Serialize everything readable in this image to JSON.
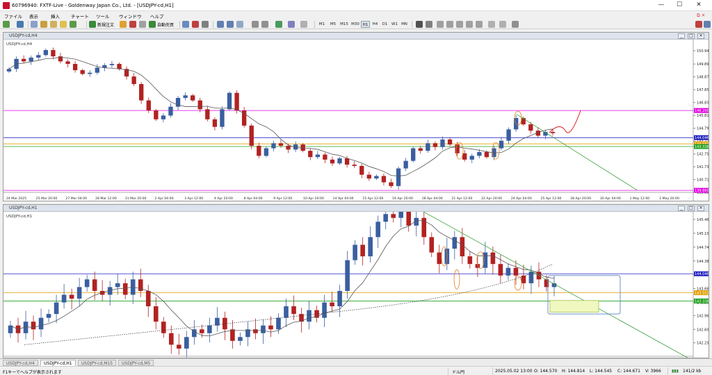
{
  "window": {
    "title": "60796940: FXTF-Live - Goldenway Japan Co., Ltd. - [USDJPY-cd,H1]",
    "minimize": "—",
    "maximize": "☐",
    "close": "✕"
  },
  "menu": [
    "ファイル",
    "表示",
    "挿入",
    "チャート",
    "ツール",
    "ウィンドウ",
    "ヘルプ"
  ],
  "toolbar": {
    "new_order": "新規注文",
    "auto_trade": "自動売買",
    "timeframes": [
      "M1",
      "M5",
      "M15",
      "M30",
      "H1",
      "H4",
      "D1",
      "W1",
      "MN"
    ]
  },
  "charts": [
    {
      "title": "USDJPY-cd,H4",
      "label": "USDJPY-cd,H4",
      "price_min": 139.7,
      "price_max": 151.5,
      "price_ticks": [
        "150.940",
        "149.890",
        "148.870",
        "147.850",
        "146.830",
        "145.810",
        "144.790",
        "143.770",
        "142.750",
        "141.730",
        "140.710",
        "139.690"
      ],
      "tick_values": [
        150.94,
        149.89,
        148.87,
        147.85,
        146.83,
        145.81,
        144.79,
        143.77,
        142.75,
        141.73,
        140.71,
        139.69
      ],
      "time_labels": [
        "24 Mar 2025",
        "25 Mar 20:00",
        "27 Mar 04:00",
        "28 Mar 12:00",
        "31 Mar 20:00",
        "2 Apr 04:00",
        "3 Apr 12:00",
        "4 Apr 20:00",
        "8 Apr 04:00",
        "9 Apr 12:00",
        "10 Apr 20:00",
        "14 Apr 04:00",
        "15 Apr 12:00",
        "16 Apr 20:00",
        "18 Apr 04:00",
        "21 Apr 12:00",
        "22 Apr 20:00",
        "24 Apr 04:00",
        "25 Apr 12:00",
        "28 Apr 20:00",
        "30 Apr 04:00",
        "1 May 12:00",
        "2 May 20:00"
      ],
      "level_tags": [
        {
          "value": 146.2,
          "text": "146.200",
          "color": "#e000e0"
        },
        {
          "value": 144.046,
          "text": "144.046",
          "color": "#2020c0"
        },
        {
          "value": 143.55,
          "text": "143.553",
          "color": "#e0a000"
        },
        {
          "value": 143.338,
          "text": "143.338",
          "color": "#20a020"
        },
        {
          "value": 139.86,
          "text": "139.860",
          "color": "#e000e0"
        }
      ],
      "close_series": [
        149.5,
        150.3,
        150.1,
        150.4,
        150.6,
        151.0,
        150.5,
        150.1,
        149.9,
        149.4,
        149.1,
        149.2,
        149.6,
        149.8,
        149.9,
        149.5,
        148.9,
        148.3,
        147.0,
        146.2,
        145.5,
        145.8,
        146.5,
        147.2,
        147.4,
        147.0,
        146.3,
        145.5,
        144.9,
        146.3,
        147.6,
        146.2,
        145.0,
        143.4,
        142.6,
        143.2,
        143.6,
        143.4,
        143.1,
        143.5,
        143.0,
        142.5,
        142.7,
        142.3,
        142.0,
        142.4,
        141.9,
        141.8,
        141.1,
        140.8,
        141.0,
        140.5,
        140.2,
        141.6,
        142.2,
        143.2,
        143.0,
        143.6,
        143.3,
        143.9,
        143.5,
        142.8,
        142.3,
        142.6,
        142.9,
        142.5,
        143.2,
        143.8,
        144.7,
        145.6,
        145.1,
        144.6,
        144.2,
        144.5,
        144.4
      ]
    },
    {
      "title": "USDJPY-cd,H1",
      "label": "USDJPY-cd,H1",
      "price_min": 141.9,
      "price_max": 145.55,
      "price_ticks": [
        "145.810",
        "145.460",
        "145.100",
        "144.740",
        "144.380",
        "144.020",
        "143.660",
        "143.300",
        "142.960",
        "142.600",
        "142.250"
      ],
      "tick_values": [
        145.81,
        145.46,
        145.1,
        144.74,
        144.38,
        144.02,
        143.66,
        143.3,
        142.96,
        142.6,
        142.25
      ],
      "level_tags": [
        {
          "value": 144.046,
          "text": "144.046",
          "color": "#2020c0"
        },
        {
          "value": 143.553,
          "text": "143.553",
          "color": "#e0a000"
        },
        {
          "value": 143.338,
          "text": "143.338",
          "color": "#20a020"
        }
      ],
      "close_series": [
        142.7,
        142.5,
        142.8,
        142.6,
        142.9,
        143.0,
        143.3,
        143.5,
        143.4,
        143.7,
        143.9,
        143.6,
        143.5,
        143.7,
        143.8,
        143.5,
        143.9,
        143.6,
        143.2,
        142.8,
        142.5,
        142.2,
        142.1,
        142.4,
        142.6,
        142.5,
        142.7,
        142.9,
        142.6,
        142.3,
        142.4,
        142.6,
        142.5,
        142.7,
        142.6,
        142.9,
        143.2,
        143.0,
        142.8,
        143.1,
        142.9,
        143.3,
        143.2,
        143.6,
        144.4,
        144.8,
        144.5,
        145.0,
        145.4,
        145.6,
        145.5,
        145.7,
        145.3,
        145.5,
        145.0,
        144.6,
        144.3,
        144.7,
        145.0,
        144.5,
        144.3,
        144.2,
        144.6,
        144.3,
        144.0,
        144.2,
        144.0,
        143.8,
        144.1,
        143.9,
        143.7,
        143.8
      ]
    }
  ],
  "tabs": [
    "USDJPY-cd,H4",
    "USDJPY-cd,H1",
    "USDJPY-cd,M15",
    "USDJPY-cd,M5"
  ],
  "status": {
    "help": "F1キーでヘルプが表示されます",
    "profile": "ドル円",
    "time": "2025.05.02 13:00",
    "open": "O: 144.570",
    "high": "H: 144.814",
    "low": "L: 144.545",
    "close": "C: 144.671",
    "volume": "V: 3966",
    "traffic": "141/2 kb"
  },
  "colors": {
    "bull": "#3a5fa0",
    "bear": "#b22222",
    "ma": "#555555"
  }
}
